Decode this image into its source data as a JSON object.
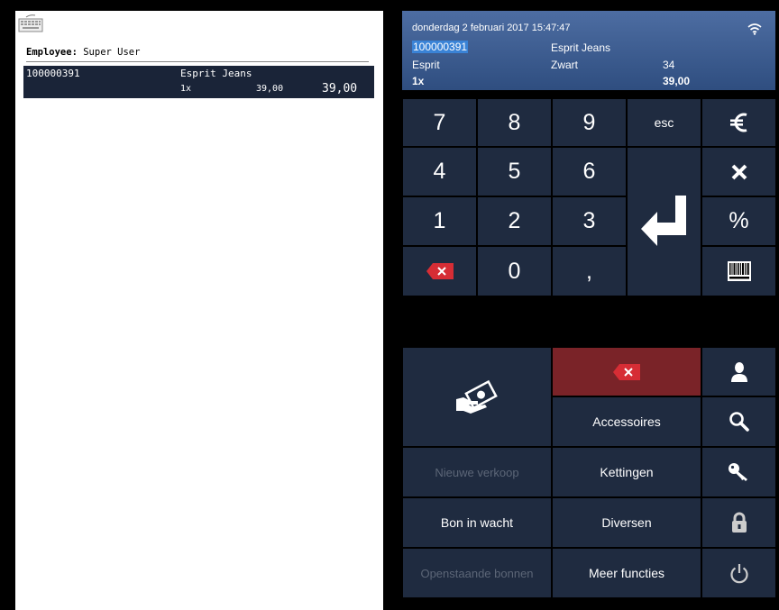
{
  "employee": {
    "label": "Employee:",
    "name": "Super User"
  },
  "receipt": {
    "lines": [
      {
        "code": "100000391",
        "name": "Esprit Jeans",
        "qty": "1x",
        "price": "39,00",
        "total": "39,00"
      }
    ]
  },
  "header": {
    "datetime": "donderdag 2 februari 2017 15:47:47",
    "code": "100000391",
    "product": "Esprit Jeans",
    "brand": "Esprit",
    "color": "Zwart",
    "size": "34",
    "qty": "1x",
    "total": "39,00"
  },
  "keypad": {
    "k7": "7",
    "k8": "8",
    "k9": "9",
    "esc": "esc",
    "k4": "4",
    "k5": "5",
    "k6": "6",
    "k1": "1",
    "k2": "2",
    "k3": "3",
    "k0": "0",
    "comma": ",",
    "percent": "%"
  },
  "functions": {
    "accessoires": "Accessoires",
    "nieuwe_verkoop": "Nieuwe verkoop",
    "kettingen": "Kettingen",
    "bon_in_wacht": "Bon in wacht",
    "diversen": "Diversen",
    "openstaande_bonnen": "Openstaande bonnen",
    "meer_functies": "Meer functies"
  },
  "colors": {
    "key_bg": "#1f2b40",
    "header_bg": "#3d5d92",
    "delete_red": "#7a2328",
    "receipt_row": "#1a2438"
  }
}
